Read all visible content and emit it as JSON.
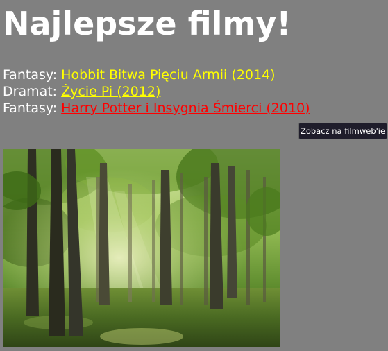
{
  "page": {
    "title": "Najlepsze filmy!"
  },
  "movies": [
    {
      "genre": "Fantasy:",
      "title": "Hobbit Bitwa Pięciu Armii (2014)",
      "link_color": "#ffff00"
    },
    {
      "genre": "Dramat:",
      "title": "Życie Pi (2012)",
      "link_color": "#ffff00"
    },
    {
      "genre": "Fantasy:",
      "title": "Harry Potter i Insygnia Śmierci (2010)",
      "link_color": "#ff0000"
    }
  ],
  "tooltip": {
    "text": "Zobacz na filmweb'ie"
  },
  "colors": {
    "background": "#808080",
    "text": "#ffffff",
    "link": "#ffff00",
    "link_hover": "#ff0000",
    "tooltip_bg": "#1f1d2b"
  },
  "image": {
    "subject": "forest-photo"
  }
}
